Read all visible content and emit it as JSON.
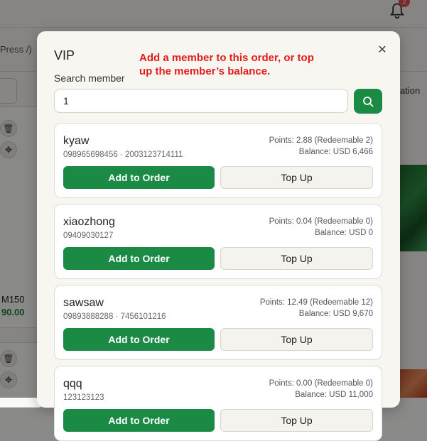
{
  "background": {
    "notification_count": "2",
    "press_text": "Press /)",
    "tab_text": "ation",
    "product_name": "M150",
    "product_price": "90.00"
  },
  "modal": {
    "title": "VIP",
    "hint": "Add a member to this order, or top up the member’s balance.",
    "search_label": "Search member",
    "search_value": "1",
    "colors": {
      "accent": "#1a8a45",
      "hint": "#e11d1d"
    }
  },
  "members": [
    {
      "name": "kyaw",
      "phones": "098965698456 · 2003123714111",
      "points": "Points: 2.88 (Redeemable 2)",
      "balance": "Balance: USD 6,466",
      "add_label": "Add to Order",
      "topup_label": "Top Up"
    },
    {
      "name": "xiaozhong",
      "phones": "09409030127",
      "points": "Points: 0.04 (Redeemable 0)",
      "balance": "Balance: USD 0",
      "add_label": "Add to Order",
      "topup_label": "Top Up"
    },
    {
      "name": "sawsaw",
      "phones": "09893888288 · 7456101216",
      "points": "Points: 12.49 (Redeemable 12)",
      "balance": "Balance: USD 9,670",
      "add_label": "Add to Order",
      "topup_label": "Top Up"
    },
    {
      "name": "qqq",
      "phones": "123123123",
      "points": "Points: 0.00 (Redeemable 0)",
      "balance": "Balance: USD 11,000",
      "add_label": "Add to Order",
      "topup_label": "Top Up"
    }
  ]
}
